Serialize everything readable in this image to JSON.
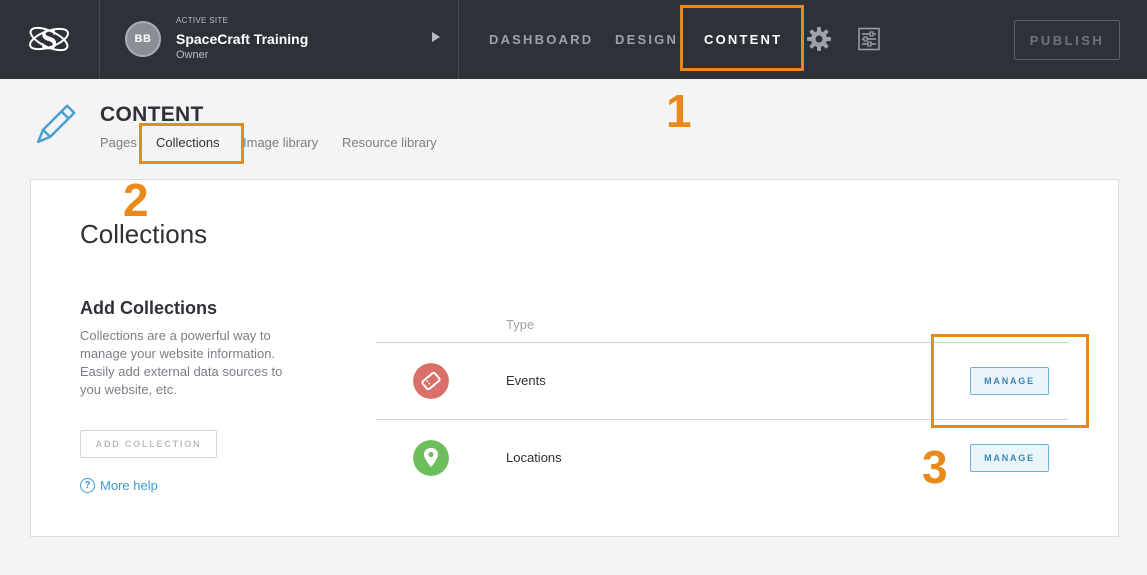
{
  "topbar": {
    "avatar_initials": "BB",
    "site_kicker": "ACTIVE SITE",
    "site_name": "SpaceCraft Training",
    "site_role": "Owner",
    "nav": [
      {
        "label": "DASHBOARD",
        "active": false
      },
      {
        "label": "DESIGN",
        "active": false
      },
      {
        "label": "CONTENT",
        "active": true
      }
    ],
    "settings_icon": "gear-icon",
    "controls_icon": "sliders-icon",
    "publish_label": "PUBLISH"
  },
  "subheader": {
    "title": "CONTENT",
    "icon": "pencil-icon",
    "tabs": [
      {
        "label": "Pages",
        "active": false
      },
      {
        "label": "Collections",
        "active": true
      },
      {
        "label": "Image library",
        "active": false
      },
      {
        "label": "Resource library",
        "active": false
      }
    ]
  },
  "main": {
    "title": "Collections",
    "add_heading": "Add Collections",
    "add_description": "Collections are a powerful way to manage your website information. Easily add external data sources to you website, etc.",
    "add_button_label": "ADD COLLECTION",
    "help_icon": "?",
    "help_label": "More help",
    "column_header": "Type",
    "rows": [
      {
        "icon": "ticket-icon",
        "icon_color": "#d9716a",
        "label": "Events",
        "action_label": "MANAGE"
      },
      {
        "icon": "map-pin-icon",
        "icon_color": "#6cbf5a",
        "label": "Locations",
        "action_label": "MANAGE"
      }
    ]
  },
  "annotations": {
    "color": "#e8891a",
    "numbers": [
      "1",
      "2",
      "3"
    ]
  },
  "colors": {
    "topbar": "#2e3238",
    "accent_blue": "#3f9bd1"
  }
}
